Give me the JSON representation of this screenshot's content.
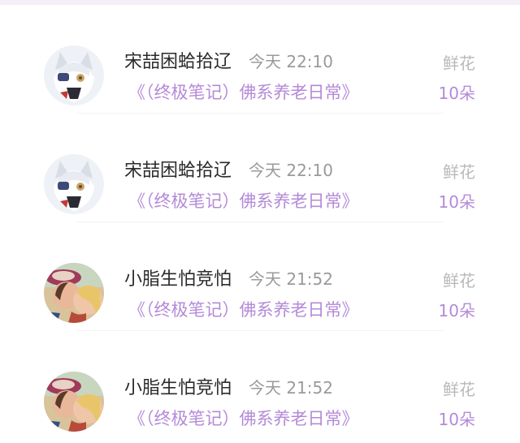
{
  "colors": {
    "accent_purple": "#b48ad8",
    "name_text": "#2b2b2b",
    "meta_gray": "#9a9a9a",
    "label_gray": "#b9b9b9",
    "top_strip": "#f6eef6"
  },
  "rows": [
    {
      "user": "宋喆困蛤拾辽",
      "time": "今天 22:10",
      "book": "《（终极笔记）佛系养老日常》",
      "gift_label": "鲜花",
      "gift_count": "10朵",
      "avatar_icon": "anime-fox-girl-avatar"
    },
    {
      "user": "宋喆困蛤拾辽",
      "time": "今天 22:10",
      "book": "《（终极笔记）佛系养老日常》",
      "gift_label": "鲜花",
      "gift_count": "10朵",
      "avatar_icon": "anime-fox-girl-avatar"
    },
    {
      "user": "小脂生怕竞怕",
      "time": "今天 21:52",
      "book": "《（终极笔记）佛系养老日常》",
      "gift_label": "鲜花",
      "gift_count": "10朵",
      "avatar_icon": "photo-couple-avatar"
    },
    {
      "user": "小脂生怕竞怕",
      "time": "今天 21:52",
      "book": "《（终极笔记）佛系养老日常》",
      "gift_label": "鲜花",
      "gift_count": "10朵",
      "avatar_icon": "photo-couple-avatar"
    }
  ]
}
